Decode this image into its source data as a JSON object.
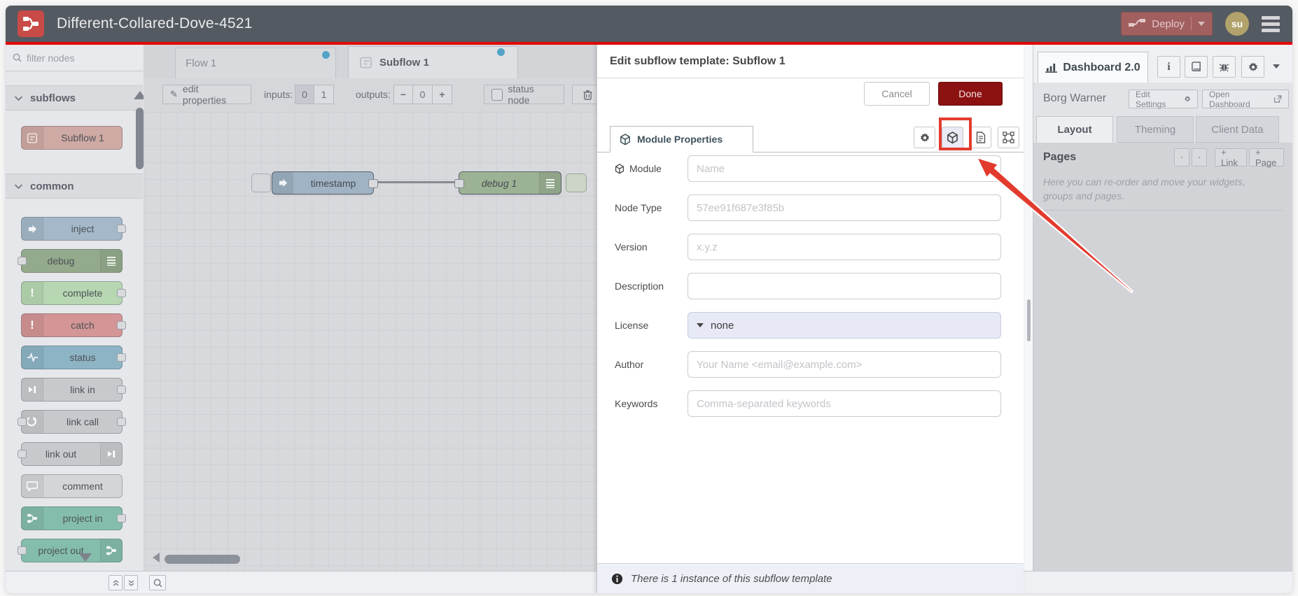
{
  "header": {
    "title": "Different-Collared-Dove-4521",
    "deploy_label": "Deploy",
    "avatar_text": "su"
  },
  "palette": {
    "filter_placeholder": "filter nodes",
    "sections": {
      "subflows": "subflows",
      "common": "common"
    },
    "nodes": {
      "subflow": "Subflow 1",
      "inject": "inject",
      "debug": "debug",
      "complete": "complete",
      "catch": "catch",
      "status": "status",
      "link_in": "link in",
      "link_call": "link call",
      "link_out": "link out",
      "comment": "comment",
      "project_in": "project in",
      "project_out": "project out"
    }
  },
  "tabs": {
    "flow": "Flow 1",
    "subflow": "Subflow 1"
  },
  "toolbar": {
    "edit_properties": "edit properties",
    "inputs_label": "inputs:",
    "input_options": [
      "0",
      "1"
    ],
    "outputs_label": "outputs:",
    "output_minus": "−",
    "output_value": "0",
    "output_plus": "+",
    "status_node": "status node"
  },
  "canvas": {
    "timestamp_label": "timestamp",
    "debug_label": "debug 1"
  },
  "tray": {
    "title": "Edit subflow template: Subflow 1",
    "cancel": "Cancel",
    "done": "Done",
    "tab": "Module Properties",
    "fields": [
      {
        "label": "Module",
        "placeholder": "Name"
      },
      {
        "label": "Node Type",
        "placeholder": "57ee91f687e3f85b"
      },
      {
        "label": "Version",
        "placeholder": "x.y.z"
      },
      {
        "label": "Description",
        "placeholder": ""
      },
      {
        "label": "License",
        "value": "none"
      },
      {
        "label": "Author",
        "placeholder": "Your Name <email@example.com>"
      },
      {
        "label": "Keywords",
        "placeholder": "Comma-separated keywords"
      }
    ],
    "instance_note": "There is 1 instance of this subflow template"
  },
  "sidebar": {
    "dashboard_tab": "Dashboard 2.0",
    "project_name": "Borg Warner",
    "edit_settings": "Edit Settings",
    "open_dashboard": "Open Dashboard",
    "tabs": [
      "Layout",
      "Theming",
      "Client Data"
    ],
    "pages_title": "Pages",
    "link_button": "+ Link",
    "page_button": "+ Page",
    "help_text": "Here you can re-order and move your widgets, groups and pages."
  },
  "colors": {
    "annotation_red": "#e23b2e",
    "done_red": "#8c1111",
    "deploy_red": "#a25f5f",
    "header_gray": "#545a61",
    "unsaved_dot_blue": "#52a3c6"
  }
}
